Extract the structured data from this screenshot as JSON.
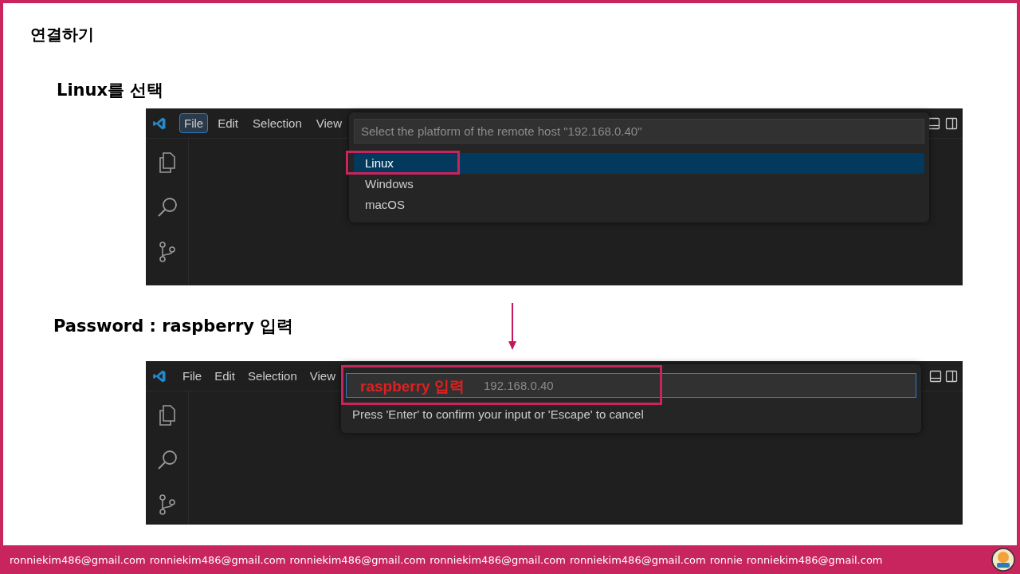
{
  "title": "연결하기",
  "steps": [
    {
      "heading": "Linux를 선택",
      "menu": [
        {
          "label": "File",
          "selected": true
        },
        {
          "label": "Edit",
          "selected": false
        },
        {
          "label": "Selection",
          "selected": false
        },
        {
          "label": "View",
          "selected": false
        }
      ],
      "quick_pick": {
        "kind": "list",
        "placeholder": "Select the platform of the remote host \"192.168.0.40\"",
        "options": [
          {
            "label": "Linux",
            "selected": true
          },
          {
            "label": "Windows",
            "selected": false
          },
          {
            "label": "macOS",
            "selected": false
          }
        ]
      }
    },
    {
      "heading": "Password : raspberry 입력",
      "menu": [
        {
          "label": "File",
          "selected": false
        },
        {
          "label": "Edit",
          "selected": false
        },
        {
          "label": "Selection",
          "selected": false
        },
        {
          "label": "View",
          "selected": false
        }
      ],
      "quick_pick": {
        "kind": "input",
        "placeholder": "192.168.0.40",
        "hint": "Press 'Enter' to confirm your input or 'Escape' to cancel",
        "annotation": "raspberry 입력"
      }
    }
  ],
  "footer": [
    "ronniekim486@gmail.com",
    "ronniekim486@gmail.com",
    "ronniekim486@gmail.com",
    "ronniekim486@gmail.com",
    "ronniekim486@gmail.com",
    "ronnie",
    "ronniekim486@gmail.com"
  ]
}
